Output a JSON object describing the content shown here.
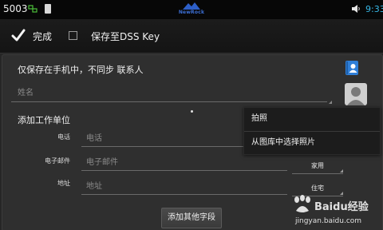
{
  "status_bar": {
    "extension": "5003",
    "time": "9:33",
    "logo_text": "NewRock",
    "icons": [
      "network-link-icon",
      "sd-card-icon",
      "volume-icon"
    ]
  },
  "action_bar": {
    "done_label": "完成",
    "save_to_dss_label": "保存至DSS Key",
    "save_to_dss_checked": false
  },
  "form": {
    "local_only_text": "仅保存在手机中，不同步 联系人",
    "name_placeholder": "姓名",
    "section_title": "添加工作单位",
    "fields": [
      {
        "label": "电话",
        "placeholder": "电话",
        "type": ""
      },
      {
        "label": "电子邮件",
        "placeholder": "电子邮件",
        "type": "家用"
      },
      {
        "label": "地址",
        "placeholder": "地址",
        "type": "住宅"
      }
    ],
    "add_more_fields_label": "添加其他字段"
  },
  "photo_menu": {
    "items": [
      "拍照",
      "从图库中选择照片"
    ]
  },
  "watermark": {
    "title": "Baidu经验",
    "url": "jingyan.baidu.com"
  },
  "colors": {
    "time": "#36b7e6",
    "brand": "#3c6fd6"
  }
}
